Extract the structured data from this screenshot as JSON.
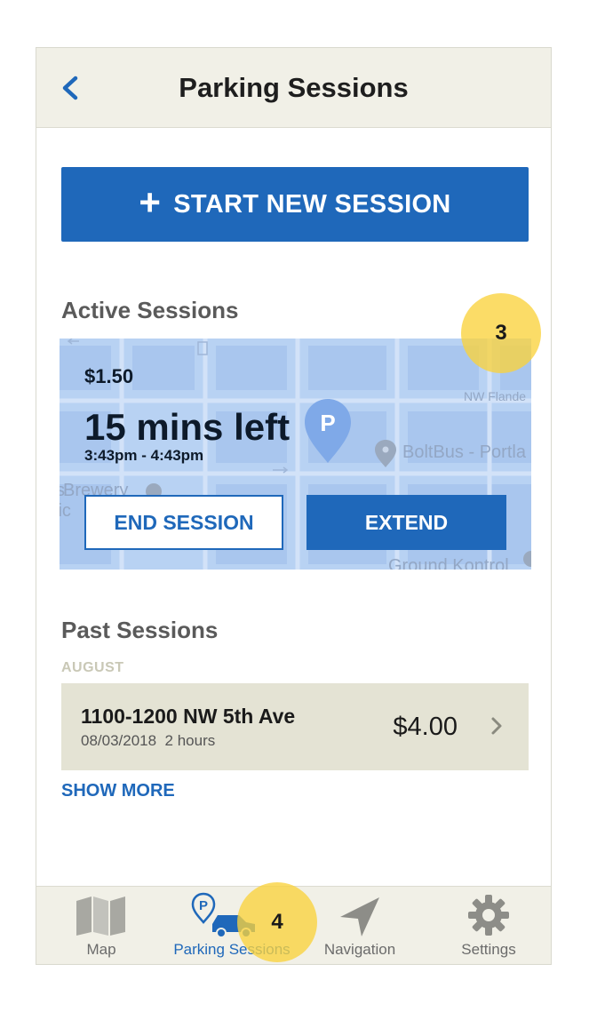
{
  "header": {
    "title": "Parking Sessions"
  },
  "start_button": {
    "icon": "plus-icon",
    "label": "START NEW SESSION"
  },
  "active": {
    "section_title": "Active Sessions",
    "price": "$1.50",
    "time_left": "15 mins left",
    "time_range": "3:43pm - 4:43pm",
    "end_label": "END SESSION",
    "extend_label": "EXTEND",
    "map_labels": {
      "street": "NW Flande",
      "poi1": "BoltBus - Portla",
      "poi2": "Brewery",
      "poi3": "Ground Kontrol",
      "lic": "lic",
      "s": "s"
    }
  },
  "past": {
    "section_title": "Past Sessions",
    "month": "AUGUST",
    "items": [
      {
        "address": "1100-1200 NW 5th Ave",
        "date": "08/03/2018",
        "duration": "2 hours",
        "amount": "$4.00"
      }
    ],
    "show_more": "SHOW MORE"
  },
  "tabs": [
    {
      "label": "Map",
      "icon": "map-icon",
      "active": false
    },
    {
      "label": "Parking Sessions",
      "icon": "parking-car-icon",
      "active": true
    },
    {
      "label": "Navigation",
      "icon": "navigation-arrow-icon",
      "active": false
    },
    {
      "label": "Settings",
      "icon": "gear-icon",
      "active": false
    }
  ],
  "annotations": {
    "badge_3": "3",
    "badge_4": "4"
  },
  "colors": {
    "primary": "#1f68ba",
    "header_bg": "#f1f0e7",
    "row_bg": "#e4e3d4",
    "badge": "#fad23c"
  }
}
